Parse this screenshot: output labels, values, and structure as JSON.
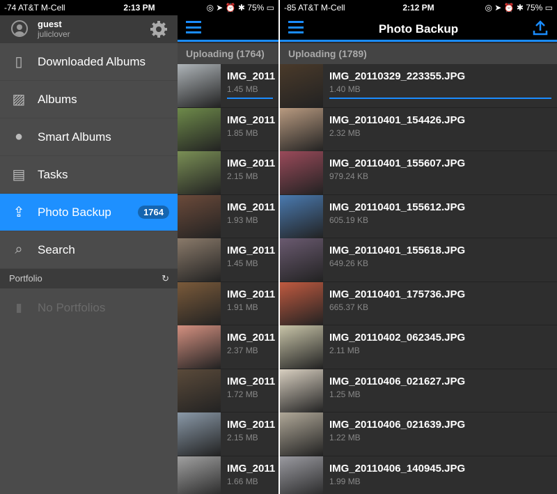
{
  "left": {
    "status": {
      "carrier": "-74 AT&T M-Cell",
      "time": "2:13 PM",
      "battery": "75%"
    },
    "drawer": {
      "user": {
        "name": "guest",
        "account": "juliclover"
      },
      "items": [
        {
          "label": "Downloaded Albums",
          "icon": "phone-icon"
        },
        {
          "label": "Albums",
          "icon": "image-icon"
        },
        {
          "label": "Smart Albums",
          "icon": "lightbulb-icon"
        },
        {
          "label": "Tasks",
          "icon": "clipboard-icon"
        },
        {
          "label": "Photo Backup",
          "icon": "upload-icon",
          "badge": "1764",
          "active": true
        },
        {
          "label": "Search",
          "icon": "search-icon"
        }
      ],
      "portfolio_header": "Portfolio",
      "no_portfolios": "No Portfolios"
    },
    "section": "Uploading (1764)",
    "rows": [
      {
        "name": "IMG_2011",
        "size": "1.45 MB",
        "c": "#aeb4b8"
      },
      {
        "name": "IMG_2011",
        "size": "1.85 MB",
        "c": "#6e8a4a"
      },
      {
        "name": "IMG_2011",
        "size": "2.15 MB",
        "c": "#7a8f55"
      },
      {
        "name": "IMG_2011",
        "size": "1.93 MB",
        "c": "#6b4a3a"
      },
      {
        "name": "IMG_2011",
        "size": "1.45 MB",
        "c": "#8a7a6a"
      },
      {
        "name": "IMG_2011",
        "size": "1.91 MB",
        "c": "#7a5a3a"
      },
      {
        "name": "IMG_2011",
        "size": "2.37 MB",
        "c": "#d49080"
      },
      {
        "name": "IMG_2011",
        "size": "1.72 MB",
        "c": "#5a4a3a"
      },
      {
        "name": "IMG_2011",
        "size": "2.15 MB",
        "c": "#8a99a8"
      },
      {
        "name": "IMG_2011",
        "size": "1.66 MB",
        "c": "#a0a0a0"
      }
    ]
  },
  "right": {
    "status": {
      "carrier": "-85 AT&T M-Cell",
      "time": "2:12 PM",
      "battery": "75%"
    },
    "title": "Photo Backup",
    "section": "Uploading (1789)",
    "rows": [
      {
        "name": "IMG_20110329_223355.JPG",
        "size": "1.40 MB",
        "c": "#4a3a2a",
        "progress": true
      },
      {
        "name": "IMG_20110401_154426.JPG",
        "size": "2.32 MB",
        "c": "#b89a80"
      },
      {
        "name": "IMG_20110401_155607.JPG",
        "size": "979.24 KB",
        "c": "#9a4a5a"
      },
      {
        "name": "IMG_20110401_155612.JPG",
        "size": "605.19 KB",
        "c": "#4a7ab0"
      },
      {
        "name": "IMG_20110401_155618.JPG",
        "size": "649.26 KB",
        "c": "#6a5a70"
      },
      {
        "name": "IMG_20110401_175736.JPG",
        "size": "665.37 KB",
        "c": "#c05a40"
      },
      {
        "name": "IMG_20110402_062345.JPG",
        "size": "2.11 MB",
        "c": "#c8c4a8"
      },
      {
        "name": "IMG_20110406_021627.JPG",
        "size": "1.25 MB",
        "c": "#d8cfc0"
      },
      {
        "name": "IMG_20110406_021639.JPG",
        "size": "1.22 MB",
        "c": "#b0a898"
      },
      {
        "name": "IMG_20110406_140945.JPG",
        "size": "1.99 MB",
        "c": "#9a9aa0"
      }
    ]
  },
  "colors": {
    "accent": "#1a8cff"
  }
}
